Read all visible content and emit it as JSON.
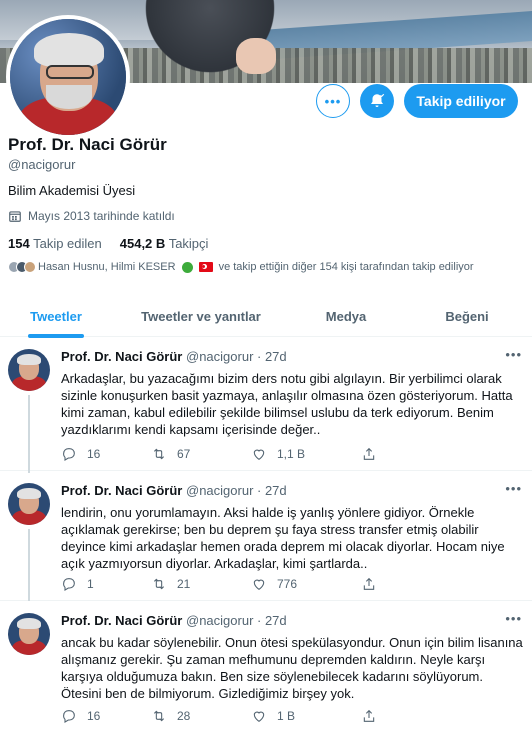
{
  "profile": {
    "name": "Prof. Dr. Naci Görür",
    "handle": "@nacigorur",
    "bio": "Bilim Akademisi Üyesi",
    "joined": "Mayıs 2013 tarihinde katıldı",
    "following_count": "154",
    "following_label": "Takip edilen",
    "followers_count": "454,2 B",
    "followers_label": "Takipçi",
    "followed_by_text_1": "Hasan Husnu, Hilmi KESER",
    "followed_by_text_2": "ve takip ettiğin diğer 154 kişi tarafından takip ediliyor"
  },
  "actions": {
    "more_label": "•••",
    "follow_label": "Takip ediliyor"
  },
  "tabs": [
    {
      "label": "Tweetler",
      "active": true
    },
    {
      "label": "Tweetler ve yanıtlar",
      "active": false
    },
    {
      "label": "Medya",
      "active": false
    },
    {
      "label": "Beğeni",
      "active": false
    }
  ],
  "tweets": [
    {
      "author": "Prof. Dr. Naci Görür",
      "meta": "@nacigorur · 27d",
      "text": "Arkadaşlar, bu yazacağımı bizim ders notu gibi algılayın. Bir yerbilimci olarak sizinle konuşurken basit yazmaya, anlaşılır olmasına özen gösteriyorum. Hatta kimi zaman, kabul edilebilir şekilde bilimsel uslubu da terk ediyorum. Benim yazdıklarımı kendi kapsamı içerisinde değer..",
      "replies": "16",
      "retweets": "67",
      "likes": "1,1 B"
    },
    {
      "author": "Prof. Dr. Naci Görür",
      "meta": "@nacigorur · 27d",
      "text": "lendirin, onu yorumlamayın. Aksi halde iş yanlış yönlere gidiyor. Örnekle açıklamak gerekirse; ben bu deprem şu faya stress transfer etmiş olabilir deyince kimi arkadaşlar hemen orada deprem mi olacak diyorlar. Hocam niye açık yazmıyorsun diyorlar. Arkadaşlar, kimi şartlarda..",
      "replies": "1",
      "retweets": "21",
      "likes": "776"
    },
    {
      "author": "Prof. Dr. Naci Görür",
      "meta": "@nacigorur · 27d",
      "text": "ancak bu kadar söylenebilir. Onun ötesi spekülasyondur. Onun için bilim lisanına alışmanız gerekir. Şu zaman mefhumunu depremden kaldırın. Neyle karşı karşıya olduğumuza bakın. Ben size söylenebilecek kadarını söylüyorum. Ötesini ben de bilmiyorum. Gizlediğimiz birşey yok.",
      "replies": "16",
      "retweets": "28",
      "likes": "1 B"
    }
  ],
  "colors": {
    "accent": "#1d9bf0",
    "text": "#0f1419",
    "muted": "#536471"
  }
}
